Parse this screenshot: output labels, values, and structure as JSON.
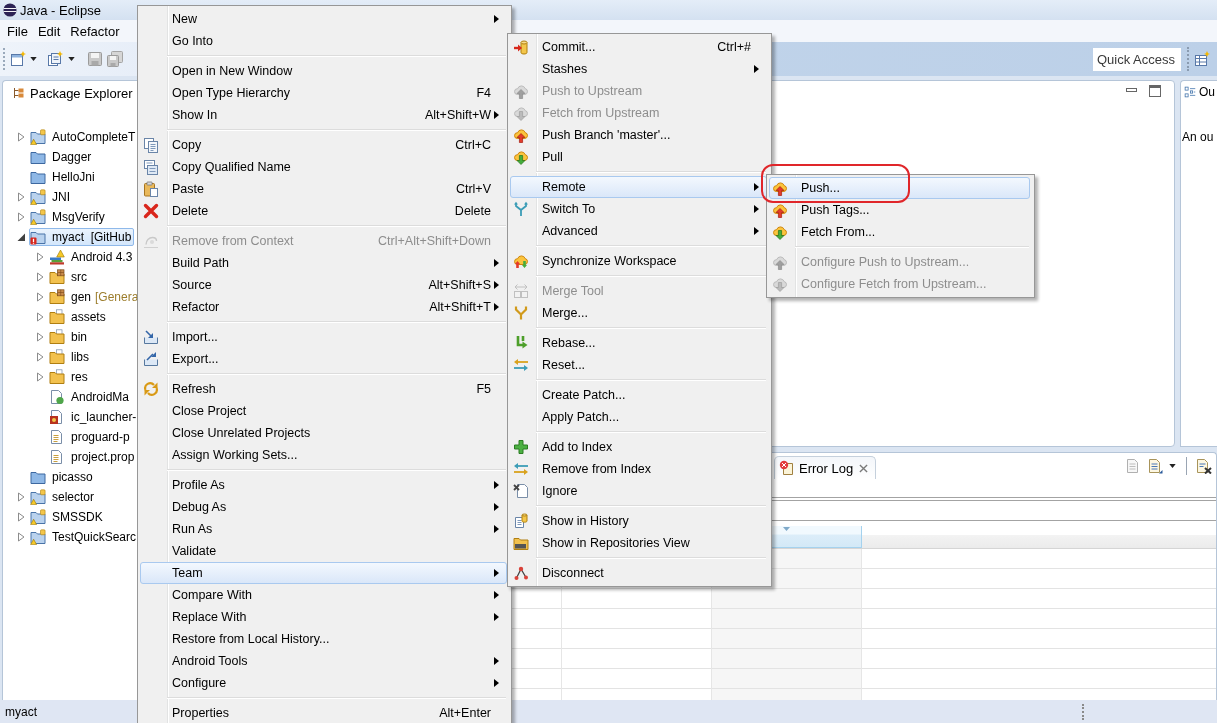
{
  "window": {
    "title": "Java - Eclipse"
  },
  "menu_bar": [
    {
      "label": "File"
    },
    {
      "label": "Edit"
    },
    {
      "label": "Refactor"
    }
  ],
  "toolbar": {
    "quick_access": {
      "placeholder": "Quick Access"
    }
  },
  "package_explorer": {
    "title": "Package Explorer",
    "tree": [
      {
        "label": "AutoCompleteT",
        "kind": "project",
        "expanded": false,
        "selected": false
      },
      {
        "label": "Dagger",
        "kind": "closed-project",
        "selected": false
      },
      {
        "label": "HelloJni",
        "kind": "closed-project",
        "selected": false
      },
      {
        "label": "JNI",
        "kind": "project",
        "expanded": false,
        "selected": false
      },
      {
        "label": "MsgVerify",
        "kind": "project",
        "expanded": false,
        "selected": false
      },
      {
        "label": "myact  [GitHub",
        "kind": "error-project",
        "expanded": true,
        "selected": true,
        "children": [
          {
            "label": "Android 4.3",
            "kind": "library",
            "expanded": false,
            "selected": false
          },
          {
            "label": "src",
            "kind": "source-folder",
            "expanded": false,
            "selected": false
          },
          {
            "label": "gen",
            "decoration": "[Genera",
            "kind": "source-folder",
            "expanded": false,
            "selected": false
          },
          {
            "label": "assets",
            "kind": "folder",
            "expanded": false,
            "selected": false
          },
          {
            "label": "bin",
            "kind": "folder",
            "expanded": false,
            "selected": false
          },
          {
            "label": "libs",
            "kind": "folder",
            "expanded": false,
            "selected": false
          },
          {
            "label": "res",
            "kind": "folder",
            "expanded": false,
            "selected": false
          },
          {
            "label": "AndroidMa",
            "kind": "xml-file",
            "selected": false
          },
          {
            "label": "ic_launcher-",
            "kind": "image-file",
            "selected": false
          },
          {
            "label": "proguard-p",
            "kind": "text-file",
            "selected": false
          },
          {
            "label": "project.prop",
            "kind": "text-file",
            "selected": false
          }
        ]
      },
      {
        "label": "picasso",
        "kind": "closed-project",
        "selected": false
      },
      {
        "label": "selector",
        "kind": "project",
        "expanded": false,
        "selected": false
      },
      {
        "label": "SMSSDK",
        "kind": "project",
        "expanded": false,
        "selected": false
      },
      {
        "label": "TestQuickSearc",
        "kind": "project",
        "expanded": false,
        "selected": false
      }
    ]
  },
  "outline": {
    "title": "Ou",
    "message": "An ou"
  },
  "bottom_panel": {
    "tabs": [
      {
        "label": "Error Log",
        "selected": true
      }
    ]
  },
  "status_bar": {
    "text": "myact"
  },
  "context_menu": {
    "items": [
      {
        "kind": "item",
        "label": "New",
        "submenu": true,
        "disabled": false,
        "selected": false
      },
      {
        "kind": "item",
        "label": "Go Into",
        "submenu": false,
        "disabled": false,
        "selected": false
      },
      {
        "kind": "separator"
      },
      {
        "kind": "item",
        "label": "Open in New Window",
        "submenu": false,
        "disabled": false,
        "selected": false
      },
      {
        "kind": "item",
        "label": "Open Type Hierarchy",
        "shortcut": "F4",
        "submenu": false,
        "disabled": false,
        "selected": false
      },
      {
        "kind": "item",
        "label": "Show In",
        "shortcut": "Alt+Shift+W",
        "submenu": true,
        "disabled": false,
        "selected": false
      },
      {
        "kind": "separator"
      },
      {
        "kind": "item",
        "label": "Copy",
        "shortcut": "Ctrl+C",
        "submenu": false,
        "disabled": false,
        "selected": false
      },
      {
        "kind": "item",
        "label": "Copy Qualified Name",
        "submenu": false,
        "disabled": false,
        "selected": false
      },
      {
        "kind": "item",
        "label": "Paste",
        "shortcut": "Ctrl+V",
        "submenu": false,
        "disabled": false,
        "selected": false
      },
      {
        "kind": "item",
        "label": "Delete",
        "shortcut": "Delete",
        "submenu": false,
        "disabled": false,
        "selected": false
      },
      {
        "kind": "separator"
      },
      {
        "kind": "item",
        "label": "Remove from Context",
        "shortcut": "Ctrl+Alt+Shift+Down",
        "submenu": false,
        "disabled": true,
        "selected": false
      },
      {
        "kind": "item",
        "label": "Build Path",
        "submenu": true,
        "disabled": false,
        "selected": false
      },
      {
        "kind": "item",
        "label": "Source",
        "shortcut": "Alt+Shift+S",
        "submenu": true,
        "disabled": false,
        "selected": false
      },
      {
        "kind": "item",
        "label": "Refactor",
        "shortcut": "Alt+Shift+T",
        "submenu": true,
        "disabled": false,
        "selected": false
      },
      {
        "kind": "separator"
      },
      {
        "kind": "item",
        "label": "Import...",
        "submenu": false,
        "disabled": false,
        "selected": false
      },
      {
        "kind": "item",
        "label": "Export...",
        "submenu": false,
        "disabled": false,
        "selected": false
      },
      {
        "kind": "separator"
      },
      {
        "kind": "item",
        "label": "Refresh",
        "shortcut": "F5",
        "submenu": false,
        "disabled": false,
        "selected": false
      },
      {
        "kind": "item",
        "label": "Close Project",
        "submenu": false,
        "disabled": false,
        "selected": false
      },
      {
        "kind": "item",
        "label": "Close Unrelated Projects",
        "submenu": false,
        "disabled": false,
        "selected": false
      },
      {
        "kind": "item",
        "label": "Assign Working Sets...",
        "submenu": false,
        "disabled": false,
        "selected": false
      },
      {
        "kind": "separator"
      },
      {
        "kind": "item",
        "label": "Profile As",
        "submenu": true,
        "disabled": false,
        "selected": false
      },
      {
        "kind": "item",
        "label": "Debug As",
        "submenu": true,
        "disabled": false,
        "selected": false
      },
      {
        "kind": "item",
        "label": "Run As",
        "submenu": true,
        "disabled": false,
        "selected": false
      },
      {
        "kind": "item",
        "label": "Validate",
        "submenu": false,
        "disabled": false,
        "selected": false
      },
      {
        "kind": "item",
        "label": "Team",
        "submenu": true,
        "disabled": false,
        "selected": true
      },
      {
        "kind": "item",
        "label": "Compare With",
        "submenu": true,
        "disabled": false,
        "selected": false
      },
      {
        "kind": "item",
        "label": "Replace With",
        "submenu": true,
        "disabled": false,
        "selected": false
      },
      {
        "kind": "item",
        "label": "Restore from Local History...",
        "submenu": false,
        "disabled": false,
        "selected": false
      },
      {
        "kind": "item",
        "label": "Android Tools",
        "submenu": true,
        "disabled": false,
        "selected": false
      },
      {
        "kind": "item",
        "label": "Configure",
        "submenu": true,
        "disabled": false,
        "selected": false
      },
      {
        "kind": "separator"
      },
      {
        "kind": "item",
        "label": "Properties",
        "shortcut": "Alt+Enter",
        "submenu": false,
        "disabled": false,
        "selected": false
      }
    ]
  },
  "team_menu": {
    "items": [
      {
        "kind": "item",
        "label": "Commit...",
        "shortcut": "Ctrl+#",
        "submenu": false,
        "disabled": false,
        "selected": false
      },
      {
        "kind": "item",
        "label": "Stashes",
        "submenu": true,
        "disabled": false,
        "selected": false
      },
      {
        "kind": "item",
        "label": "Push to Upstream",
        "submenu": false,
        "disabled": true,
        "selected": false
      },
      {
        "kind": "item",
        "label": "Fetch from Upstream",
        "submenu": false,
        "disabled": true,
        "selected": false
      },
      {
        "kind": "item",
        "label": "Push Branch 'master'...",
        "submenu": false,
        "disabled": false,
        "selected": false
      },
      {
        "kind": "item",
        "label": "Pull",
        "submenu": false,
        "disabled": false,
        "selected": false
      },
      {
        "kind": "separator"
      },
      {
        "kind": "item",
        "label": "Remote",
        "submenu": true,
        "disabled": false,
        "selected": true
      },
      {
        "kind": "item",
        "label": "Switch To",
        "submenu": true,
        "disabled": false,
        "selected": false
      },
      {
        "kind": "item",
        "label": "Advanced",
        "submenu": true,
        "disabled": false,
        "selected": false
      },
      {
        "kind": "separator"
      },
      {
        "kind": "item",
        "label": "Synchronize Workspace",
        "submenu": false,
        "disabled": false,
        "selected": false
      },
      {
        "kind": "separator"
      },
      {
        "kind": "item",
        "label": "Merge Tool",
        "submenu": false,
        "disabled": true,
        "selected": false
      },
      {
        "kind": "item",
        "label": "Merge...",
        "submenu": false,
        "disabled": false,
        "selected": false
      },
      {
        "kind": "separator"
      },
      {
        "kind": "item",
        "label": "Rebase...",
        "submenu": false,
        "disabled": false,
        "selected": false
      },
      {
        "kind": "item",
        "label": "Reset...",
        "submenu": false,
        "disabled": false,
        "selected": false
      },
      {
        "kind": "separator"
      },
      {
        "kind": "item",
        "label": "Create Patch...",
        "submenu": false,
        "disabled": false,
        "selected": false
      },
      {
        "kind": "item",
        "label": "Apply Patch...",
        "submenu": false,
        "disabled": false,
        "selected": false
      },
      {
        "kind": "separator"
      },
      {
        "kind": "item",
        "label": "Add to Index",
        "submenu": false,
        "disabled": false,
        "selected": false
      },
      {
        "kind": "item",
        "label": "Remove from Index",
        "submenu": false,
        "disabled": false,
        "selected": false
      },
      {
        "kind": "item",
        "label": "Ignore",
        "submenu": false,
        "disabled": false,
        "selected": false
      },
      {
        "kind": "separator"
      },
      {
        "kind": "item",
        "label": "Show in History",
        "submenu": false,
        "disabled": false,
        "selected": false
      },
      {
        "kind": "item",
        "label": "Show in Repositories View",
        "submenu": false,
        "disabled": false,
        "selected": false
      },
      {
        "kind": "separator"
      },
      {
        "kind": "item",
        "label": "Disconnect",
        "submenu": false,
        "disabled": false,
        "selected": false
      }
    ]
  },
  "remote_menu": {
    "items": [
      {
        "kind": "item",
        "label": "Push...",
        "submenu": false,
        "disabled": false,
        "selected": true
      },
      {
        "kind": "item",
        "label": "Push Tags...",
        "submenu": false,
        "disabled": false,
        "selected": false
      },
      {
        "kind": "item",
        "label": "Fetch From...",
        "submenu": false,
        "disabled": false,
        "selected": false
      },
      {
        "kind": "separator"
      },
      {
        "kind": "item",
        "label": "Configure Push to Upstream...",
        "submenu": false,
        "disabled": true,
        "selected": false
      },
      {
        "kind": "item",
        "label": "Configure Fetch from Upstream...",
        "submenu": false,
        "disabled": true,
        "selected": false
      }
    ]
  }
}
